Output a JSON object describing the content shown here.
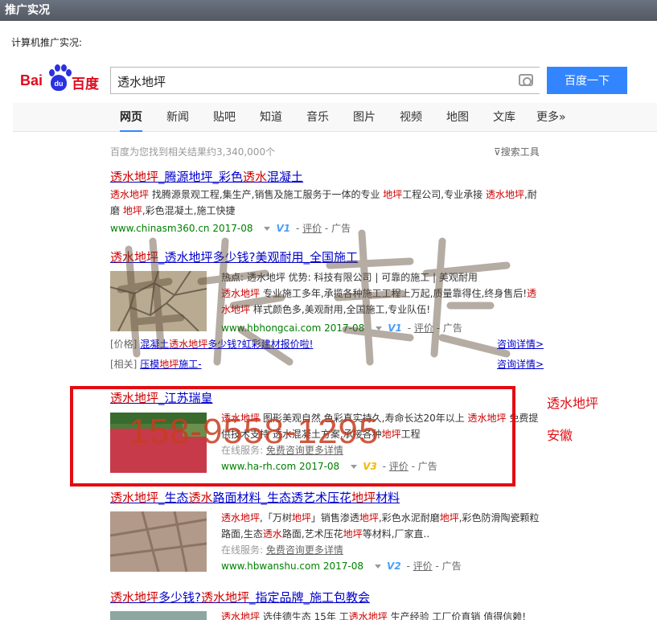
{
  "window": {
    "title": "推广实况"
  },
  "panel": {
    "label": "计算机推广实况:"
  },
  "logo": {
    "bai": "Bai",
    "du": "du",
    "cn": "百度"
  },
  "search": {
    "query": "透水地坪",
    "button": "百度一下"
  },
  "nav": {
    "tabs": [
      "网页",
      "新闻",
      "贴吧",
      "知道",
      "音乐",
      "图片",
      "视频",
      "地图",
      "文库",
      "更多»"
    ],
    "active": "网页"
  },
  "stats": {
    "count_text": "百度为您找到相关结果约3,340,000个",
    "tools_label": "搜索工具"
  },
  "common": {
    "rate": "评价",
    "ad": "广告"
  },
  "results": [
    {
      "title": [
        "透水地坪",
        "_腾源地坪_彩色",
        "透水",
        "混凝土"
      ],
      "desc": [
        "透水地坪",
        " 找腾源景观工程,集生产,销售及施工服务于一体的专业 ",
        "地坪",
        "工程公司,专业承接 ",
        "透水地坪",
        ",耐磨 ",
        "地坪",
        ",彩色混凝土,施工快捷"
      ],
      "url": "www.chinasm360.cn",
      "date": "2017-08",
      "vbadge": "V1"
    },
    {
      "title": [
        "透水地坪",
        "_透水地坪",
        "多少钱?美观耐用_全国施工"
      ],
      "desc_line1": "热点: 透水地坪     优势: 科技有限公司 | 可靠的施工 | 美观耐用",
      "desc": [
        "透水地坪",
        " 专业施工多年,承揽各种施工工程上万起,质量靠得住,终身售后!",
        "透水地坪",
        " 样式颜色多,美观耐用,全国施工,专业队伍!"
      ],
      "url": "www.hbhongcai.com",
      "date": "2017-08",
      "vbadge": "V1",
      "sitelink1_prefix": "[价格]",
      "sitelink1": [
        "混凝土",
        "透水地坪",
        "多少钱?虹彩建材报价啦!"
      ],
      "sitelink1_right": "咨询详情>",
      "sitelink2_prefix": "[相关]",
      "sitelink2": [
        "压模",
        "地坪",
        "施工-"
      ],
      "sitelink2_right": "咨询详情>"
    },
    {
      "title": [
        "透水地坪",
        "_江苏瑞皇"
      ],
      "desc": [
        "透水地坪",
        " 图形美观自然,色彩真实持久,寿命长达20年以上 ",
        "透水地坪",
        " 免费提供技术支持 透水混凝土方案,承接各种",
        "地坪",
        "工程"
      ],
      "online_prefix": "在线服务: ",
      "online_link": "免费咨询更多详情",
      "url": "www.ha-rh.com",
      "date": "2017-08",
      "vbadge": "V3"
    },
    {
      "title": [
        "透水地坪",
        "_生态",
        "透水",
        "路面材料_生态透艺术压花",
        "地坪",
        "材料"
      ],
      "desc": [
        "透水地坪",
        ",「万树",
        "地坪",
        "」销售渗透",
        "地坪",
        ",彩色水泥耐磨",
        "地坪",
        ",彩色防滑陶瓷颗粒路面,生态",
        "透水",
        "路面,艺术压花",
        "地坪",
        "等材料,厂家直.."
      ],
      "online_prefix": "在线服务: ",
      "online_link": "免费咨询更多详情",
      "url": "www.hbwanshu.com",
      "date": "2017-08",
      "vbadge": "V2"
    },
    {
      "title": [
        "透水地坪",
        "多少钱?",
        "透水地坪",
        "_指定品牌_施工包教会"
      ],
      "desc_partial": [
        "透水地坪",
        " 选佳德生态 15年 工",
        "透水地坪",
        " 生产经验 工厂价直销 值得信赖!"
      ]
    }
  ],
  "overlay": {
    "phone": "158-9558-1295",
    "side_note1": "透水地坪",
    "side_note2": "安徽"
  },
  "colors": {
    "link": "#0000cc",
    "highlight": "#cc0000",
    "url_green": "#008000",
    "accent_blue": "#3385ff",
    "annotation_red": "#e30b13"
  }
}
